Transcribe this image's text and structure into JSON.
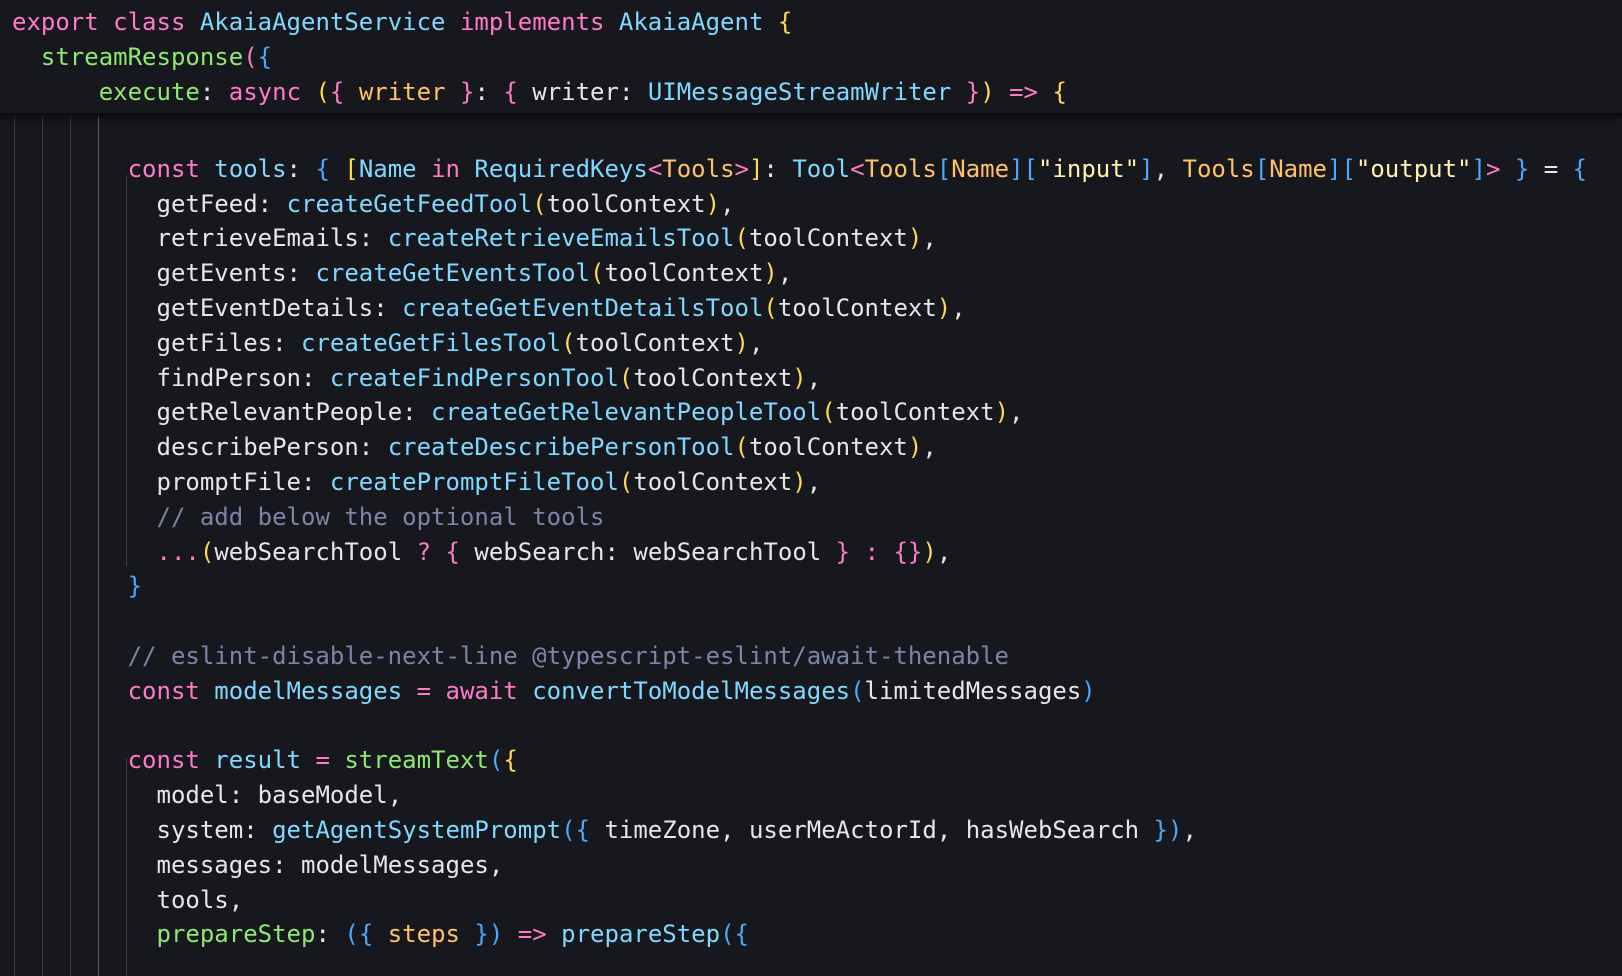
{
  "editor": {
    "language": "typescript",
    "theme_colors": {
      "background": "#16181d",
      "keyword": "#ff7ac6",
      "function": "#7fd8ff",
      "definition": "#8fe870",
      "parameter": "#ffc266",
      "string": "#fff2b0",
      "comment": "#7c84a8",
      "text": "#e6e6e6",
      "bracket_1": "#ffd94f",
      "bracket_2": "#ff7ac6",
      "bracket_3": "#4aa8ff"
    },
    "sticky_scroll": [
      {
        "tokens": [
          [
            "kw",
            "export"
          ],
          [
            "pn",
            " "
          ],
          [
            "kw",
            "class"
          ],
          [
            "pn",
            " "
          ],
          [
            "ty",
            "AkaiaAgentService"
          ],
          [
            "pn",
            " "
          ],
          [
            "kw",
            "implements"
          ],
          [
            "pn",
            " "
          ],
          [
            "ty",
            "AkaiaAgent"
          ],
          [
            "pn",
            " "
          ],
          [
            "p1",
            "{"
          ]
        ]
      },
      {
        "tokens": [
          [
            "pn",
            "  "
          ],
          [
            "def",
            "streamResponse"
          ],
          [
            "p2",
            "("
          ],
          [
            "p3",
            "{"
          ]
        ]
      },
      {
        "tokens": [
          [
            "pn",
            "      "
          ],
          [
            "def",
            "execute"
          ],
          [
            "pn",
            ": "
          ],
          [
            "kw",
            "async"
          ],
          [
            "pn",
            " "
          ],
          [
            "p1",
            "("
          ],
          [
            "p2",
            "{"
          ],
          [
            "pn",
            " "
          ],
          [
            "param",
            "writer"
          ],
          [
            "pn",
            " "
          ],
          [
            "p2",
            "}"
          ],
          [
            "pn",
            ": "
          ],
          [
            "p2",
            "{"
          ],
          [
            "pn",
            " "
          ],
          [
            "prop",
            "writer"
          ],
          [
            "pn",
            ": "
          ],
          [
            "ty",
            "UIMessageStreamWriter"
          ],
          [
            "pn",
            " "
          ],
          [
            "p2",
            "}"
          ],
          [
            "p1",
            ")"
          ],
          [
            "pn",
            " "
          ],
          [
            "op",
            "=>"
          ],
          [
            "pn",
            " "
          ],
          [
            "p1",
            "{"
          ]
        ]
      }
    ],
    "lines": [
      {
        "tokens": []
      },
      {
        "tokens": [
          [
            "pn",
            "        "
          ],
          [
            "kw",
            "const"
          ],
          [
            "pn",
            " "
          ],
          [
            "fn",
            "tools"
          ],
          [
            "pn",
            ": "
          ],
          [
            "p3",
            "{"
          ],
          [
            "pn",
            " "
          ],
          [
            "p1",
            "["
          ],
          [
            "ty",
            "Name"
          ],
          [
            "pn",
            " "
          ],
          [
            "kw",
            "in"
          ],
          [
            "pn",
            " "
          ],
          [
            "ty",
            "RequiredKeys"
          ],
          [
            "p2",
            "<"
          ],
          [
            "param",
            "Tools"
          ],
          [
            "p2",
            ">"
          ],
          [
            "p1",
            "]"
          ],
          [
            "pn",
            ": "
          ],
          [
            "ty",
            "Tool"
          ],
          [
            "p2",
            "<"
          ],
          [
            "param",
            "Tools"
          ],
          [
            "p3",
            "["
          ],
          [
            "param",
            "Name"
          ],
          [
            "p3",
            "]"
          ],
          [
            "p3",
            "["
          ],
          [
            "str",
            "\"input\""
          ],
          [
            "p3",
            "]"
          ],
          [
            "pn",
            ", "
          ],
          [
            "param",
            "Tools"
          ],
          [
            "p3",
            "["
          ],
          [
            "param",
            "Name"
          ],
          [
            "p3",
            "]"
          ],
          [
            "p3",
            "["
          ],
          [
            "str",
            "\"output\""
          ],
          [
            "p3",
            "]"
          ],
          [
            "p2",
            ">"
          ],
          [
            "pn",
            " "
          ],
          [
            "p3",
            "}"
          ],
          [
            "pn",
            " = "
          ],
          [
            "p3",
            "{"
          ]
        ]
      },
      {
        "tokens": [
          [
            "pn",
            "          "
          ],
          [
            "prop",
            "getFeed"
          ],
          [
            "pn",
            ": "
          ],
          [
            "fn",
            "createGetFeedTool"
          ],
          [
            "p1",
            "("
          ],
          [
            "prop",
            "toolContext"
          ],
          [
            "p1",
            ")"
          ],
          [
            "pn",
            ","
          ]
        ]
      },
      {
        "tokens": [
          [
            "pn",
            "          "
          ],
          [
            "prop",
            "retrieveEmails"
          ],
          [
            "pn",
            ": "
          ],
          [
            "fn",
            "createRetrieveEmailsTool"
          ],
          [
            "p1",
            "("
          ],
          [
            "prop",
            "toolContext"
          ],
          [
            "p1",
            ")"
          ],
          [
            "pn",
            ","
          ]
        ]
      },
      {
        "tokens": [
          [
            "pn",
            "          "
          ],
          [
            "prop",
            "getEvents"
          ],
          [
            "pn",
            ": "
          ],
          [
            "fn",
            "createGetEventsTool"
          ],
          [
            "p1",
            "("
          ],
          [
            "prop",
            "toolContext"
          ],
          [
            "p1",
            ")"
          ],
          [
            "pn",
            ","
          ]
        ]
      },
      {
        "tokens": [
          [
            "pn",
            "          "
          ],
          [
            "prop",
            "getEventDetails"
          ],
          [
            "pn",
            ": "
          ],
          [
            "fn",
            "createGetEventDetailsTool"
          ],
          [
            "p1",
            "("
          ],
          [
            "prop",
            "toolContext"
          ],
          [
            "p1",
            ")"
          ],
          [
            "pn",
            ","
          ]
        ]
      },
      {
        "tokens": [
          [
            "pn",
            "          "
          ],
          [
            "prop",
            "getFiles"
          ],
          [
            "pn",
            ": "
          ],
          [
            "fn",
            "createGetFilesTool"
          ],
          [
            "p1",
            "("
          ],
          [
            "prop",
            "toolContext"
          ],
          [
            "p1",
            ")"
          ],
          [
            "pn",
            ","
          ]
        ]
      },
      {
        "tokens": [
          [
            "pn",
            "          "
          ],
          [
            "prop",
            "findPerson"
          ],
          [
            "pn",
            ": "
          ],
          [
            "fn",
            "createFindPersonTool"
          ],
          [
            "p1",
            "("
          ],
          [
            "prop",
            "toolContext"
          ],
          [
            "p1",
            ")"
          ],
          [
            "pn",
            ","
          ]
        ]
      },
      {
        "tokens": [
          [
            "pn",
            "          "
          ],
          [
            "prop",
            "getRelevantPeople"
          ],
          [
            "pn",
            ": "
          ],
          [
            "fn",
            "createGetRelevantPeopleTool"
          ],
          [
            "p1",
            "("
          ],
          [
            "prop",
            "toolContext"
          ],
          [
            "p1",
            ")"
          ],
          [
            "pn",
            ","
          ]
        ]
      },
      {
        "tokens": [
          [
            "pn",
            "          "
          ],
          [
            "prop",
            "describePerson"
          ],
          [
            "pn",
            ": "
          ],
          [
            "fn",
            "createDescribePersonTool"
          ],
          [
            "p1",
            "("
          ],
          [
            "prop",
            "toolContext"
          ],
          [
            "p1",
            ")"
          ],
          [
            "pn",
            ","
          ]
        ]
      },
      {
        "tokens": [
          [
            "pn",
            "          "
          ],
          [
            "prop",
            "promptFile"
          ],
          [
            "pn",
            ": "
          ],
          [
            "fn",
            "createPromptFileTool"
          ],
          [
            "p1",
            "("
          ],
          [
            "prop",
            "toolContext"
          ],
          [
            "p1",
            ")"
          ],
          [
            "pn",
            ","
          ]
        ]
      },
      {
        "tokens": [
          [
            "pn",
            "          "
          ],
          [
            "cm",
            "// add below the optional tools"
          ]
        ]
      },
      {
        "tokens": [
          [
            "pn",
            "          "
          ],
          [
            "op",
            "..."
          ],
          [
            "p1",
            "("
          ],
          [
            "prop",
            "webSearchTool"
          ],
          [
            "pn",
            " "
          ],
          [
            "op",
            "?"
          ],
          [
            "pn",
            " "
          ],
          [
            "p2",
            "{"
          ],
          [
            "pn",
            " "
          ],
          [
            "prop",
            "webSearch"
          ],
          [
            "pn",
            ": "
          ],
          [
            "prop",
            "webSearchTool"
          ],
          [
            "pn",
            " "
          ],
          [
            "p2",
            "}"
          ],
          [
            "pn",
            " "
          ],
          [
            "op",
            ":"
          ],
          [
            "pn",
            " "
          ],
          [
            "p2",
            "{}"
          ],
          [
            "p1",
            ")"
          ],
          [
            "pn",
            ","
          ]
        ]
      },
      {
        "tokens": [
          [
            "pn",
            "        "
          ],
          [
            "p3",
            "}"
          ]
        ]
      },
      {
        "tokens": []
      },
      {
        "tokens": [
          [
            "pn",
            "        "
          ],
          [
            "cm",
            "// eslint-disable-next-line @typescript-eslint/await-thenable"
          ]
        ]
      },
      {
        "tokens": [
          [
            "pn",
            "        "
          ],
          [
            "kw",
            "const"
          ],
          [
            "pn",
            " "
          ],
          [
            "fn",
            "modelMessages"
          ],
          [
            "pn",
            " "
          ],
          [
            "op",
            "="
          ],
          [
            "pn",
            " "
          ],
          [
            "kw",
            "await"
          ],
          [
            "pn",
            " "
          ],
          [
            "fn",
            "convertToModelMessages"
          ],
          [
            "p3",
            "("
          ],
          [
            "prop",
            "limitedMessages"
          ],
          [
            "p3",
            ")"
          ]
        ]
      },
      {
        "tokens": []
      },
      {
        "tokens": [
          [
            "pn",
            "        "
          ],
          [
            "kw",
            "const"
          ],
          [
            "pn",
            " "
          ],
          [
            "fn",
            "result"
          ],
          [
            "pn",
            " "
          ],
          [
            "op",
            "="
          ],
          [
            "pn",
            " "
          ],
          [
            "def",
            "streamText"
          ],
          [
            "p3",
            "("
          ],
          [
            "p1",
            "{"
          ]
        ]
      },
      {
        "tokens": [
          [
            "pn",
            "          "
          ],
          [
            "prop",
            "model"
          ],
          [
            "pn",
            ": "
          ],
          [
            "prop",
            "baseModel"
          ],
          [
            "pn",
            ","
          ]
        ]
      },
      {
        "tokens": [
          [
            "pn",
            "          "
          ],
          [
            "prop",
            "system"
          ],
          [
            "pn",
            ": "
          ],
          [
            "fn",
            "getAgentSystemPrompt"
          ],
          [
            "p3",
            "("
          ],
          [
            "p3",
            "{"
          ],
          [
            "pn",
            " "
          ],
          [
            "prop",
            "timeZone"
          ],
          [
            "pn",
            ", "
          ],
          [
            "prop",
            "userMeActorId"
          ],
          [
            "pn",
            ", "
          ],
          [
            "prop",
            "hasWebSearch"
          ],
          [
            "pn",
            " "
          ],
          [
            "p3",
            "}"
          ],
          [
            "p3",
            ")"
          ],
          [
            "pn",
            ","
          ]
        ]
      },
      {
        "tokens": [
          [
            "pn",
            "          "
          ],
          [
            "prop",
            "messages"
          ],
          [
            "pn",
            ": "
          ],
          [
            "prop",
            "modelMessages"
          ],
          [
            "pn",
            ","
          ]
        ]
      },
      {
        "tokens": [
          [
            "pn",
            "          "
          ],
          [
            "prop",
            "tools"
          ],
          [
            "pn",
            ","
          ]
        ]
      },
      {
        "tokens": [
          [
            "pn",
            "          "
          ],
          [
            "def",
            "prepareStep"
          ],
          [
            "pn",
            ": "
          ],
          [
            "p3",
            "("
          ],
          [
            "p3",
            "{"
          ],
          [
            "pn",
            " "
          ],
          [
            "param",
            "steps"
          ],
          [
            "pn",
            " "
          ],
          [
            "p3",
            "}"
          ],
          [
            "p3",
            ")"
          ],
          [
            "pn",
            " "
          ],
          [
            "op",
            "=>"
          ],
          [
            "pn",
            " "
          ],
          [
            "fn",
            "prepareStep"
          ],
          [
            "p3",
            "("
          ],
          [
            "p3",
            "{"
          ]
        ]
      }
    ]
  }
}
